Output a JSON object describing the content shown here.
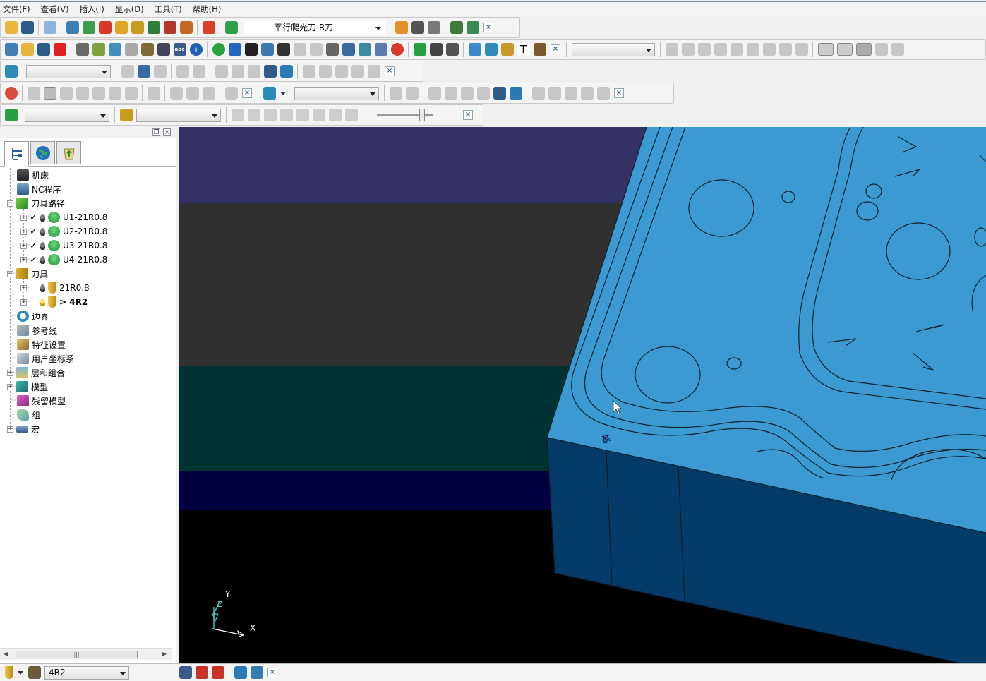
{
  "menu": [
    "文件(F)",
    "查看(V)",
    "插入(I)",
    "显示(D)",
    "工具(T)",
    "帮助(H)"
  ],
  "toolbar": {
    "strategy_combo": "平行爬光刀 R刀"
  },
  "status": {
    "tool_combo": "4R2"
  },
  "tree": {
    "machine": "机床",
    "nc": "NC程序",
    "toolpaths": "刀具路径",
    "toolpath_items": [
      "U1-21R0.8",
      "U2-21R0.8",
      "U3-21R0.8",
      "U4-21R0.8"
    ],
    "tools": "刀具",
    "tool_items": [
      "21R0.8",
      "> 4R2"
    ],
    "boundary": "边界",
    "pattern": "参考线",
    "feature": "特征设置",
    "ucs": "用户坐标系",
    "levels": "层和组合",
    "model": "模型",
    "stock": "残留模型",
    "group": "组",
    "macro": "宏"
  },
  "axis": {
    "y": "Y",
    "x": "X",
    "z": "Z"
  },
  "colors": {
    "part": "#3b9ad2",
    "side": "#053b69",
    "bg_top": "#343264",
    "bg_mid": "#303030",
    "bg_teal": "#003232",
    "bg_navy": "#00003e"
  }
}
